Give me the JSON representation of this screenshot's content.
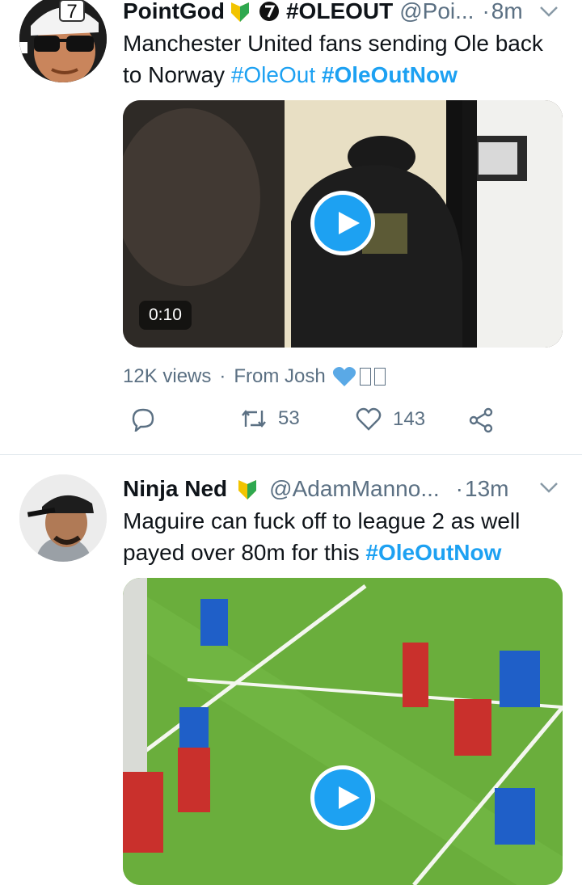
{
  "tweets": [
    {
      "name": "PointGod",
      "name_extra": "#OLEOUT",
      "handle": "@Poi...",
      "time": "8m",
      "text_plain": "Manchester United fans sending Ole back to Norway",
      "tags": [
        "#OleOut",
        "#OleOutNow"
      ],
      "video_duration": "0:10",
      "views": "12K views",
      "from": "From Josh",
      "replies": "",
      "retweets": "53",
      "likes": "143",
      "badge_text": "7"
    },
    {
      "name": "Ninja Ned",
      "handle": "@AdamManno...",
      "time": "13m",
      "text_plain": "Maguire can fuck off to league 2 as well payed over 80m for this",
      "tags": [
        "#OleOutNow"
      ]
    }
  ],
  "colors": {
    "accent": "#1da1f2",
    "muted": "#5b7083",
    "divider": "#e1e8ed"
  },
  "icons": [
    "verified-badge-icon",
    "number-seven-icon",
    "chevron-down-icon",
    "play-icon",
    "heart-icon",
    "reply-icon",
    "retweet-icon",
    "like-icon",
    "share-icon"
  ]
}
